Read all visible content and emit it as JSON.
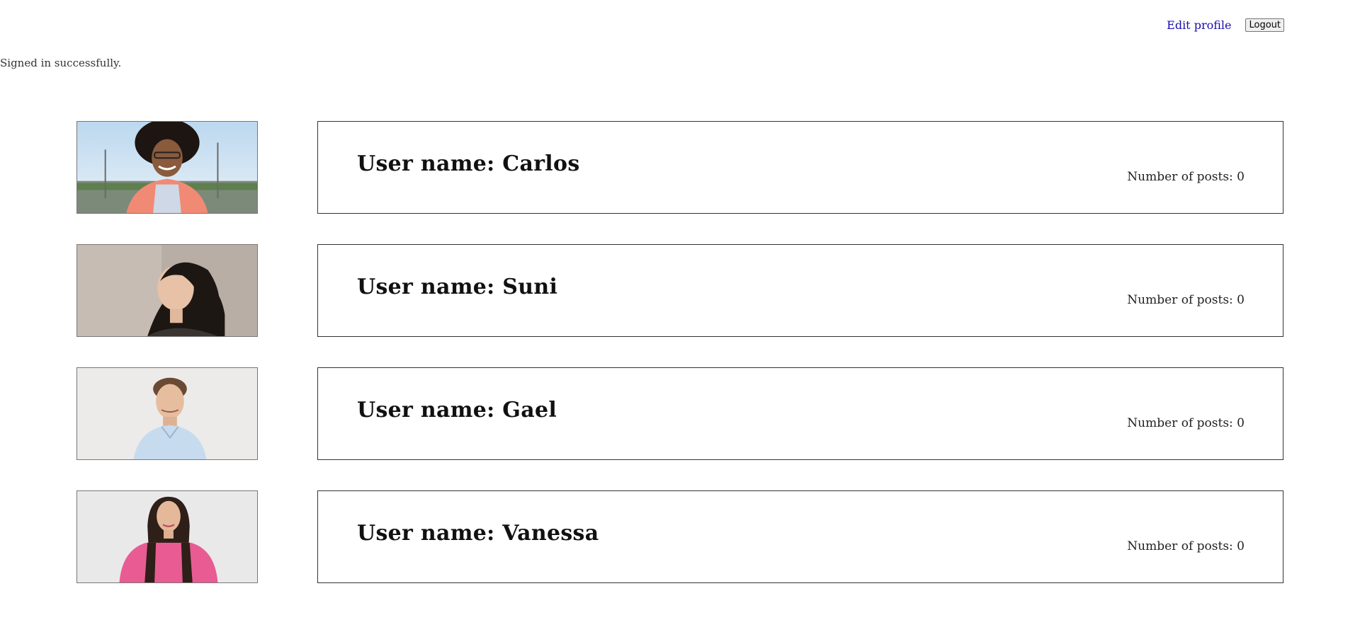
{
  "header": {
    "edit_profile_label": "Edit profile",
    "logout_label": "Logout"
  },
  "notice": "Signed in successfully.",
  "users": [
    {
      "name_line": "User name: Carlos",
      "posts_line": "Number of posts: 0",
      "photo": "carlos-photo"
    },
    {
      "name_line": "User name: Suni",
      "posts_line": "Number of posts: 0",
      "photo": "suni-photo"
    },
    {
      "name_line": "User name: Gael",
      "posts_line": "Number of posts: 0",
      "photo": "gael-photo"
    },
    {
      "name_line": "User name: Vanessa",
      "posts_line": "Number of posts: 0",
      "photo": "vanessa-photo"
    }
  ]
}
